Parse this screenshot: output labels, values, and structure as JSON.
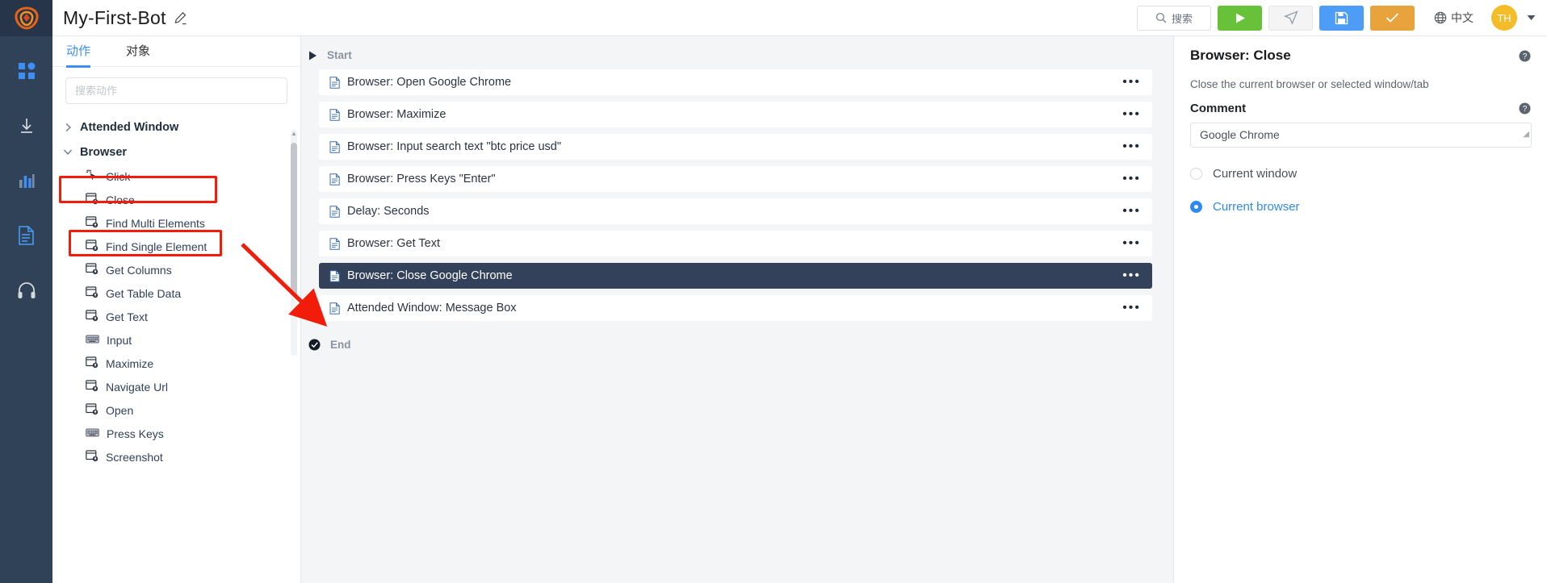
{
  "brand": {
    "accent": "#3d8ef5",
    "logo_icon": "app-logo-icon",
    "logo_color": "#e8631a"
  },
  "rail": {
    "items": [
      {
        "icon": "dashboard-grid-icon",
        "name": "rail-item-dashboard",
        "color": "#3d8ef5"
      },
      {
        "icon": "download-icon",
        "name": "rail-item-download",
        "color": "#d4d9e0"
      },
      {
        "icon": "bar-chart-icon",
        "name": "rail-item-reports",
        "color": "#3d8ef5"
      },
      {
        "icon": "document-icon",
        "name": "rail-item-logs",
        "color": "#4a9bf0"
      },
      {
        "icon": "headset-icon",
        "name": "rail-item-support",
        "color": "#d4d9e0"
      }
    ]
  },
  "header": {
    "bot_name": "My-First-Bot",
    "edit_icon": "pencil-edit-icon",
    "search_label": "搜索",
    "search_icon": "search-icon",
    "buttons": [
      {
        "name": "run-button",
        "icon": "play-icon",
        "color": "#67c23a"
      },
      {
        "name": "step-run-button",
        "icon": "paper-plane-icon",
        "color": "#f4f4f5"
      },
      {
        "name": "save-button",
        "icon": "floppy-disk-icon",
        "color": "#4d9df6"
      },
      {
        "name": "confirm-button",
        "icon": "check-icon",
        "color": "#e8a33d"
      }
    ],
    "language_label": "中文",
    "language_icon": "globe-icon",
    "avatar_initials": "TH",
    "avatar_color": "#f5bc2a",
    "caret_icon": "caret-down-icon"
  },
  "actions_panel": {
    "tabs": [
      {
        "label": "动作",
        "active": true
      },
      {
        "label": "对象",
        "active": false
      }
    ],
    "search_placeholder": "搜索动作",
    "tree": [
      {
        "type": "group",
        "label": "Attended Window",
        "expanded": false,
        "chevron": "chevron-right-icon"
      },
      {
        "type": "group",
        "label": "Browser",
        "expanded": true,
        "chevron": "chevron-down-icon",
        "highlighted": true
      },
      {
        "type": "item",
        "label": "Click",
        "icon": "cursor-click-icon"
      },
      {
        "type": "item",
        "label": "Close",
        "icon": "browser-window-icon",
        "highlighted": true
      },
      {
        "type": "item",
        "label": "Find Multi Elements",
        "icon": "browser-window-icon"
      },
      {
        "type": "item",
        "label": "Find Single Element",
        "icon": "browser-window-icon"
      },
      {
        "type": "item",
        "label": "Get Columns",
        "icon": "browser-window-icon"
      },
      {
        "type": "item",
        "label": "Get Table Data",
        "icon": "browser-window-icon"
      },
      {
        "type": "item",
        "label": "Get Text",
        "icon": "browser-window-icon"
      },
      {
        "type": "item",
        "label": "Input",
        "icon": "keyboard-icon"
      },
      {
        "type": "item",
        "label": "Maximize",
        "icon": "browser-window-icon"
      },
      {
        "type": "item",
        "label": "Navigate Url",
        "icon": "browser-window-icon"
      },
      {
        "type": "item",
        "label": "Open",
        "icon": "browser-window-icon"
      },
      {
        "type": "item",
        "label": "Press Keys",
        "icon": "keyboard-icon"
      },
      {
        "type": "item",
        "label": "Screenshot",
        "icon": "browser-window-icon"
      }
    ]
  },
  "canvas": {
    "start_label": "Start",
    "start_icon": "play-triangle-icon",
    "end_label": "End",
    "end_icon": "check-circle-icon",
    "row_menu_icon": "ellipsis-icon",
    "step_icon": "document-icon",
    "steps": [
      {
        "label": "Browser: Open Google Chrome",
        "selected": false
      },
      {
        "label": "Browser: Maximize",
        "selected": false
      },
      {
        "label": "Browser: Input search text \"btc price usd\"",
        "selected": false
      },
      {
        "label": "Browser: Press Keys \"Enter\"",
        "selected": false
      },
      {
        "label": "Delay: Seconds",
        "selected": false
      },
      {
        "label": "Browser: Get Text",
        "selected": false
      },
      {
        "label": "Browser: Close Google Chrome",
        "selected": true
      },
      {
        "label": "Attended Window: Message Box",
        "selected": false
      }
    ]
  },
  "properties": {
    "title": "Browser: Close",
    "help_icon": "help-circle-icon",
    "description": "Close the current browser or selected window/tab",
    "comment_label": "Comment",
    "comment_value": "Google Chrome",
    "resize_icon": "resize-grip-icon",
    "options": [
      {
        "label": "Current window",
        "selected": false
      },
      {
        "label": "Current browser",
        "selected": true
      }
    ]
  }
}
